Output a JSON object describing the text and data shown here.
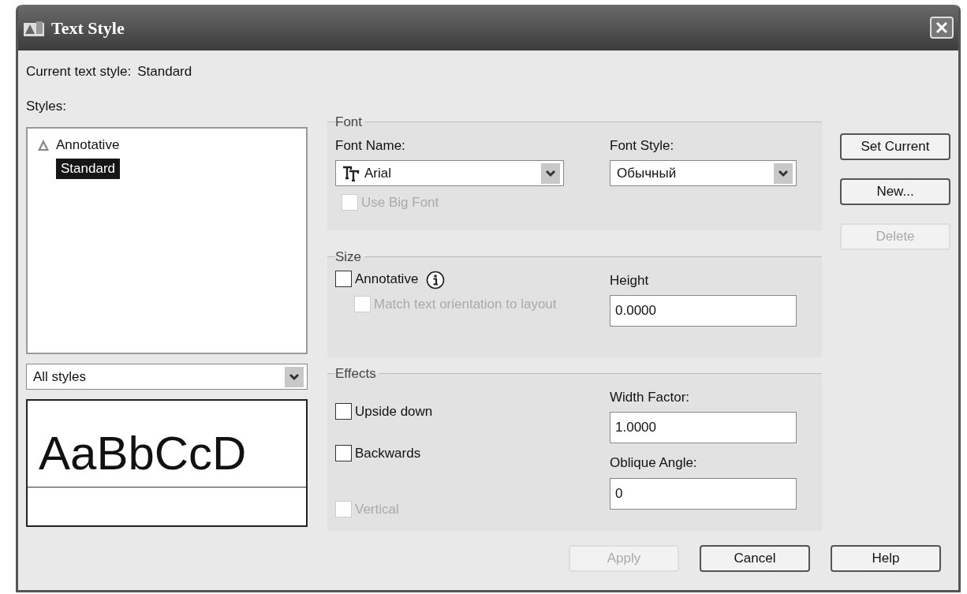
{
  "window": {
    "title": "Text Style"
  },
  "current_style": {
    "label": "Current text style:",
    "value": "Standard"
  },
  "styles": {
    "label": "Styles:",
    "items": [
      {
        "name": "Annotative",
        "annotative": true,
        "selected": false
      },
      {
        "name": "Standard",
        "annotative": false,
        "selected": true
      }
    ]
  },
  "filter": {
    "value": "All styles"
  },
  "preview": {
    "sample": "AaBbCcD"
  },
  "font": {
    "title": "Font",
    "font_name": {
      "label": "Font Name:",
      "value": "Arial"
    },
    "font_style": {
      "label": "Font Style:",
      "value": "Обычный"
    },
    "big_font": {
      "label": "Use Big Font",
      "checked": false,
      "disabled": true
    }
  },
  "size": {
    "title": "Size",
    "annotative": {
      "label": "Annotative",
      "checked": false,
      "disabled": false
    },
    "match": {
      "label": "Match text orientation to layout",
      "checked": false,
      "disabled": true
    },
    "height": {
      "label": "Height",
      "value": "0.0000"
    }
  },
  "effects": {
    "title": "Effects",
    "checks": [
      {
        "label": "Upside down",
        "checked": false,
        "disabled": false
      },
      {
        "label": "Backwards",
        "checked": false,
        "disabled": false
      },
      {
        "label": "Vertical",
        "checked": false,
        "disabled": true
      }
    ],
    "width_factor": {
      "label": "Width Factor:",
      "value": "1.0000"
    },
    "oblique": {
      "label": "Oblique Angle:",
      "value": "0"
    }
  },
  "side_buttons": [
    {
      "label": "Set Current",
      "disabled": false
    },
    {
      "label": "New...",
      "disabled": false
    },
    {
      "label": "Delete",
      "disabled": true
    }
  ],
  "bottom_buttons": [
    {
      "label": "Apply",
      "disabled": true
    },
    {
      "label": "Cancel",
      "disabled": false
    },
    {
      "label": "Help",
      "disabled": false
    }
  ]
}
